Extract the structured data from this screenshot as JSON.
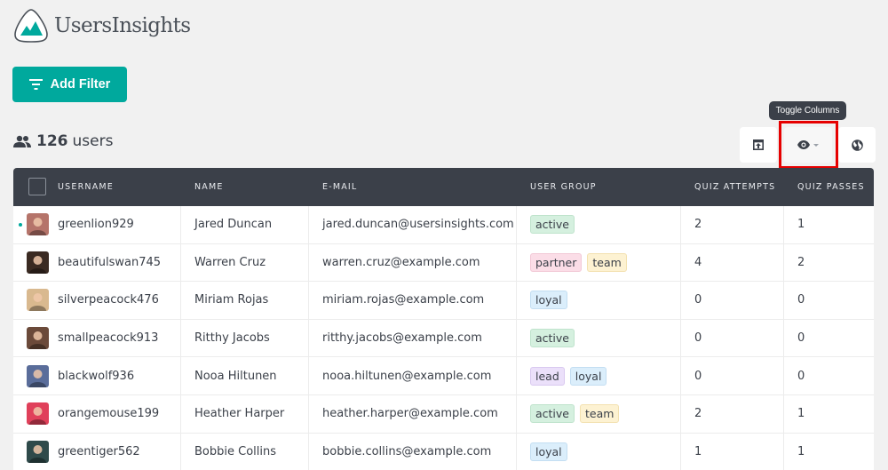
{
  "app": {
    "name": "UsersInsights",
    "brand_color": "#00a99d"
  },
  "toolbar": {
    "add_filter_label": "Add Filter",
    "users_count": "126",
    "users_label": "users",
    "tooltip": "Toggle Columns"
  },
  "table": {
    "columns": [
      "USERNAME",
      "NAME",
      "E-MAIL",
      "USER GROUP",
      "QUIZ ATTEMPTS",
      "QUIZ PASSES"
    ],
    "rows": [
      {
        "username": "greenlion929",
        "name": "Jared Duncan",
        "email": "jared.duncan@usersinsights.com",
        "groups": [
          "active"
        ],
        "quiz_attempts": "2",
        "quiz_passes": "1",
        "online": true,
        "avatar_color": "#b5746a"
      },
      {
        "username": "beautifulswan745",
        "name": "Warren Cruz",
        "email": "warren.cruz@example.com",
        "groups": [
          "partner",
          "team"
        ],
        "quiz_attempts": "4",
        "quiz_passes": "2",
        "online": false,
        "avatar_color": "#3a2a22"
      },
      {
        "username": "silverpeacock476",
        "name": "Miriam Rojas",
        "email": "miriam.rojas@example.com",
        "groups": [
          "loyal"
        ],
        "quiz_attempts": "0",
        "quiz_passes": "0",
        "online": false,
        "avatar_color": "#d9b98f"
      },
      {
        "username": "smallpeacock913",
        "name": "Ritthy Jacobs",
        "email": "ritthy.jacobs@example.com",
        "groups": [
          "active"
        ],
        "quiz_attempts": "0",
        "quiz_passes": "0",
        "online": false,
        "avatar_color": "#6b4a3a"
      },
      {
        "username": "blackwolf936",
        "name": "Nooa Hiltunen",
        "email": "nooa.hiltunen@example.com",
        "groups": [
          "lead",
          "loyal"
        ],
        "quiz_attempts": "0",
        "quiz_passes": "0",
        "online": false,
        "avatar_color": "#5a6d9a"
      },
      {
        "username": "orangemouse199",
        "name": "Heather Harper",
        "email": "heather.harper@example.com",
        "groups": [
          "active",
          "team"
        ],
        "quiz_attempts": "2",
        "quiz_passes": "1",
        "online": false,
        "avatar_color": "#e0405a"
      },
      {
        "username": "greentiger562",
        "name": "Bobbie Collins",
        "email": "bobbie.collins@example.com",
        "groups": [
          "loyal"
        ],
        "quiz_attempts": "1",
        "quiz_passes": "1",
        "online": false,
        "avatar_color": "#2f4a4a"
      }
    ]
  },
  "tag_styles": {
    "active": {
      "bg": "#d5f0df",
      "border": "#bfe3cc"
    },
    "partner": {
      "bg": "#fbdde7",
      "border": "#f2c8d6"
    },
    "team": {
      "bg": "#fdf2d2",
      "border": "#f3e1b0"
    },
    "loyal": {
      "bg": "#dbeefb",
      "border": "#c3def2"
    },
    "lead": {
      "bg": "#ebe0fa",
      "border": "#d9c9f0"
    }
  }
}
